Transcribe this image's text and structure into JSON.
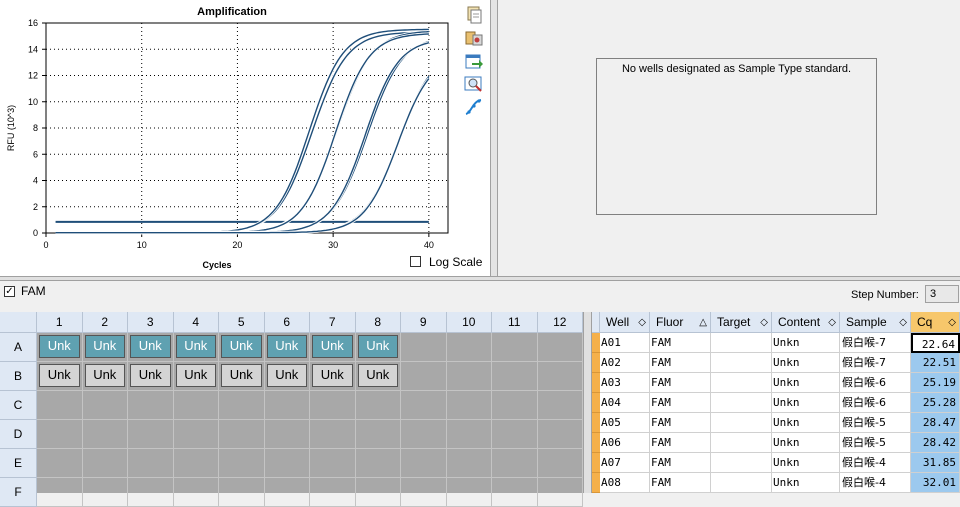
{
  "chart": {
    "title": "Amplification",
    "xlabel": "Cycles",
    "ylabel": "RFU (10^3)",
    "log_scale_label": "Log Scale",
    "log_scale_checked": false
  },
  "chart_data": {
    "type": "line",
    "title": "Amplification",
    "xlabel": "Cycles",
    "ylabel": "RFU (10^3)",
    "xlim": [
      0,
      42
    ],
    "ylim": [
      0,
      16
    ],
    "xticks": [
      0,
      10,
      20,
      30,
      40
    ],
    "yticks": [
      0,
      2,
      4,
      6,
      8,
      10,
      12,
      14,
      16
    ],
    "grid": true,
    "threshold": 0.85,
    "series": [
      {
        "cq": 22.64,
        "max": 15.3
      },
      {
        "cq": 22.51,
        "max": 15.5
      },
      {
        "cq": 25.19,
        "max": 15.4
      },
      {
        "cq": 25.28,
        "max": 15.2
      },
      {
        "cq": 28.47,
        "max": 15.0
      },
      {
        "cq": 28.42,
        "max": 14.8
      },
      {
        "cq": 31.85,
        "max": 14.0
      },
      {
        "cq": 32.01,
        "max": 13.6
      }
    ]
  },
  "toolbar": {
    "icons": [
      "copy-icon",
      "paste-settings-icon",
      "export-icon",
      "zoom-icon",
      "curve-icon"
    ]
  },
  "standard_panel": {
    "message": "No wells designated as Sample Type standard."
  },
  "fluor_filter": {
    "label": "FAM",
    "checked": true
  },
  "step": {
    "label": "Step Number:",
    "value": "3"
  },
  "plate": {
    "columns": [
      "1",
      "2",
      "3",
      "4",
      "5",
      "6",
      "7",
      "8",
      "9",
      "10",
      "11",
      "12"
    ],
    "rows": [
      "A",
      "B",
      "C",
      "D",
      "E",
      "F"
    ],
    "wells": {
      "A": [
        "Unk",
        "Unk",
        "Unk",
        "Unk",
        "Unk",
        "Unk",
        "Unk",
        "Unk"
      ],
      "B": [
        "Unk",
        "Unk",
        "Unk",
        "Unk",
        "Unk",
        "Unk",
        "Unk",
        "Unk"
      ]
    }
  },
  "table": {
    "headers": [
      "Well",
      "Fluor",
      "Target",
      "Content",
      "Sample",
      "Cq"
    ],
    "sort_markers": [
      "◇",
      "△",
      "◇",
      "◇",
      "◇",
      "◇"
    ],
    "rows": [
      [
        "A01",
        "FAM",
        "",
        "Unkn",
        "假白喉-7",
        "22.64"
      ],
      [
        "A02",
        "FAM",
        "",
        "Unkn",
        "假白喉-7",
        "22.51"
      ],
      [
        "A03",
        "FAM",
        "",
        "Unkn",
        "假白喉-6",
        "25.19"
      ],
      [
        "A04",
        "FAM",
        "",
        "Unkn",
        "假白喉-6",
        "25.28"
      ],
      [
        "A05",
        "FAM",
        "",
        "Unkn",
        "假白喉-5",
        "28.47"
      ],
      [
        "A06",
        "FAM",
        "",
        "Unkn",
        "假白喉-5",
        "28.42"
      ],
      [
        "A07",
        "FAM",
        "",
        "Unkn",
        "假白喉-4",
        "31.85"
      ],
      [
        "A08",
        "FAM",
        "",
        "Unkn",
        "假白喉-4",
        "32.01"
      ]
    ]
  },
  "colors": {
    "curve": "#1f4e79",
    "well_unknown_a": "#5fa1b1",
    "cq_column": "#9cc9ee",
    "row_marker": "#f5b04a"
  }
}
